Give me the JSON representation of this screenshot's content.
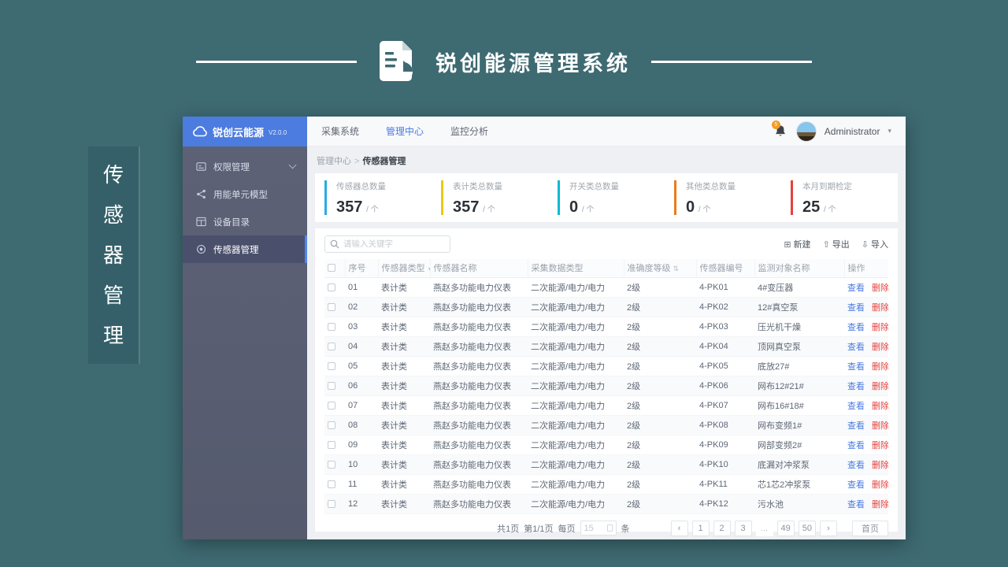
{
  "banner": {
    "title": "锐创能源管理系统"
  },
  "side_label": {
    "text": "传感器管理"
  },
  "logo": {
    "name": "锐创云能源",
    "version": "V2.0.0"
  },
  "topnav": {
    "items": [
      {
        "label": "采集系统",
        "active": false
      },
      {
        "label": "管理中心",
        "active": true
      },
      {
        "label": "监控分析",
        "active": false
      }
    ],
    "notification_badge": "5",
    "username": "Administrator"
  },
  "sidebar": {
    "items": [
      {
        "label": "权限管理",
        "icon": "permission-icon",
        "chevron": true,
        "active": false
      },
      {
        "label": "用能单元模型",
        "icon": "energy-unit-icon",
        "chevron": false,
        "active": false
      },
      {
        "label": "设备目录",
        "icon": "device-catalog-icon",
        "chevron": false,
        "active": false
      },
      {
        "label": "传感器管理",
        "icon": "sensor-icon",
        "chevron": false,
        "active": true
      }
    ]
  },
  "breadcrumb": {
    "parent": "管理中心",
    "separator": ">",
    "current": "传感器管理"
  },
  "stats": [
    {
      "label": "传感器总数量",
      "value": "357",
      "unit": "/ 个",
      "color": "#29abe2"
    },
    {
      "label": "表计类总数量",
      "value": "357",
      "unit": "/ 个",
      "color": "#e8c913"
    },
    {
      "label": "开关类总数量",
      "value": "0",
      "unit": "/ 个",
      "color": "#00bcd4"
    },
    {
      "label": "其他类总数量",
      "value": "0",
      "unit": "/ 个",
      "color": "#e87d1e"
    },
    {
      "label": "本月到期检定",
      "value": "25",
      "unit": "/ 个",
      "color": "#e5413d"
    }
  ],
  "toolbar": {
    "search_placeholder": "请输入关键字",
    "new_label": "新建",
    "export_label": "导出",
    "import_label": "导入"
  },
  "table": {
    "headers": [
      "序号",
      "传感器类型",
      "传感器名称",
      "采集数据类型",
      "准确度等级",
      "传感器编号",
      "监测对象名称",
      "操作"
    ],
    "view_label": "查看",
    "delete_label": "删除",
    "rows": [
      {
        "no": "01",
        "type": "表计类",
        "name": "燕赵多功能电力仪表",
        "data_type": "二次能源/电力/电力",
        "accuracy": "2级",
        "code": "4-PK01",
        "target": "4#变压器"
      },
      {
        "no": "02",
        "type": "表计类",
        "name": "燕赵多功能电力仪表",
        "data_type": "二次能源/电力/电力",
        "accuracy": "2级",
        "code": "4-PK02",
        "target": "12#真空泵"
      },
      {
        "no": "03",
        "type": "表计类",
        "name": "燕赵多功能电力仪表",
        "data_type": "二次能源/电力/电力",
        "accuracy": "2级",
        "code": "4-PK03",
        "target": "压光机干燥"
      },
      {
        "no": "04",
        "type": "表计类",
        "name": "燕赵多功能电力仪表",
        "data_type": "二次能源/电力/电力",
        "accuracy": "2级",
        "code": "4-PK04",
        "target": "顶网真空泵"
      },
      {
        "no": "05",
        "type": "表计类",
        "name": "燕赵多功能电力仪表",
        "data_type": "二次能源/电力/电力",
        "accuracy": "2级",
        "code": "4-PK05",
        "target": "底放27#"
      },
      {
        "no": "06",
        "type": "表计类",
        "name": "燕赵多功能电力仪表",
        "data_type": "二次能源/电力/电力",
        "accuracy": "2级",
        "code": "4-PK06",
        "target": "网布12#21#"
      },
      {
        "no": "07",
        "type": "表计类",
        "name": "燕赵多功能电力仪表",
        "data_type": "二次能源/电力/电力",
        "accuracy": "2级",
        "code": "4-PK07",
        "target": "网布16#18#"
      },
      {
        "no": "08",
        "type": "表计类",
        "name": "燕赵多功能电力仪表",
        "data_type": "二次能源/电力/电力",
        "accuracy": "2级",
        "code": "4-PK08",
        "target": "网布变频1#"
      },
      {
        "no": "09",
        "type": "表计类",
        "name": "燕赵多功能电力仪表",
        "data_type": "二次能源/电力/电力",
        "accuracy": "2级",
        "code": "4-PK09",
        "target": "网部变频2#"
      },
      {
        "no": "10",
        "type": "表计类",
        "name": "燕赵多功能电力仪表",
        "data_type": "二次能源/电力/电力",
        "accuracy": "2级",
        "code": "4-PK10",
        "target": "底漏对冲浆泵"
      },
      {
        "no": "11",
        "type": "表计类",
        "name": "燕赵多功能电力仪表",
        "data_type": "二次能源/电力/电力",
        "accuracy": "2级",
        "code": "4-PK11",
        "target": "芯1芯2冲浆泵"
      },
      {
        "no": "12",
        "type": "表计类",
        "name": "燕赵多功能电力仪表",
        "data_type": "二次能源/电力/电力",
        "accuracy": "2级",
        "code": "4-PK12",
        "target": "污水池"
      }
    ]
  },
  "pagination": {
    "total_pages": "共1页",
    "current": "第1/1页",
    "per_page_prefix": "每页",
    "per_page_value": "15",
    "per_page_suffix": "条",
    "prev": "‹",
    "next": "›",
    "pages": [
      "1",
      "2",
      "3",
      "...",
      "49",
      "50"
    ],
    "first_label": "首页"
  }
}
